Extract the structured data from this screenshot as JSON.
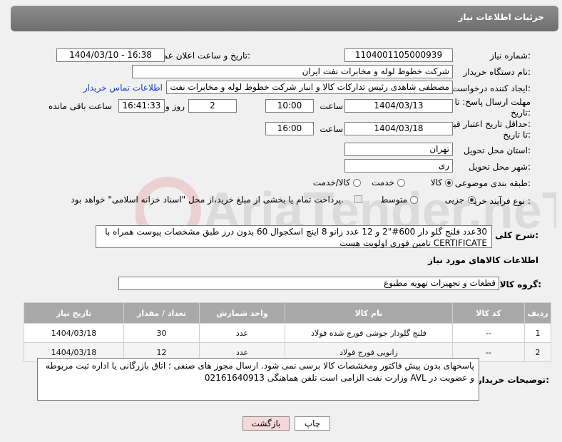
{
  "header": {
    "title": "جزئیات اطلاعات نیاز"
  },
  "watermark": {
    "text": "AriaTender.neT"
  },
  "fields": {
    "need_number_label": "شماره نیاز:",
    "need_number": "1104001105000939",
    "announce_label": "تاریخ و ساعت اعلان عمومی:",
    "announce_value": "1404/03/10 - 16:38",
    "buyer_label": "نام دستگاه خریدار:",
    "buyer_value": "شرکت خطوط لوله و مخابرات نفت ایران",
    "creator_label": "ایجاد کننده درخواست:",
    "creator_value": "مصطفی  شاهدی رئیس تدارکات کالا و انبار شرکت خطوط لوله و مخابرات نفت ایر",
    "contact_link": "اطلاعات تماس خریدار",
    "deadline_label_1": "مهلت ارسال پاسخ: تا",
    "deadline_label_2": "تاریخ:",
    "deadline_date": "1404/03/13",
    "time_label": "ساعت",
    "deadline_time": "10:00",
    "days_value": "2",
    "days_label": "روز و",
    "remaining_time": "16:41:33",
    "remaining_label": "ساعت باقی مانده",
    "validity_label_1": "حداقل تاریخ اعتبار قیمت:",
    "validity_label_2": "تا تاریخ:",
    "validity_date": "1404/03/18",
    "validity_time_label": "ساعت",
    "validity_time": "16:00",
    "province_label": "استان محل تحویل:",
    "province_value": "تهران",
    "city_label": "شهر محل تحویل:",
    "city_value": "ری",
    "category_label": "طبقه بندی موضوعی:",
    "category_options": [
      "کالا",
      "خدمت",
      "کالا/خدمت"
    ],
    "category_selected": "کالا",
    "process_label": "نوع فرآیند خرید :",
    "process_options": [
      "جزیی",
      "متوسط"
    ],
    "process_selected": "جزیی",
    "payment_text": "پرداخت تمام یا بخشی از مبلغ خرید،از محل \"اسناد خزانه اسلامی\" خواهد بود."
  },
  "description": {
    "label": "شرح کلی نیاز:",
    "line1": "30عدد فلنج گلو دار  600#\"2 و 12 عدد زانو 8 اینچ اسکجوال 60 بدون درز طبق مشخصات پیوست همراه با",
    "line2": "CERTIFICATE تامین فوری  اولویت هست"
  },
  "goods_section": {
    "title": "اطلاعات کالاهای مورد نیاز",
    "group_label": "گروه کالا:",
    "group_value": "قطعات و تجهیزات تهویه مطبوع"
  },
  "table": {
    "headers": [
      "ردیف",
      "کد کالا",
      "نام کالا",
      "واحد شمارش",
      "تعداد / مقدار",
      "تاریخ نیاز"
    ],
    "rows": [
      [
        "1",
        "--",
        "فلنج گلودار جوشی فورج شده فولاد",
        "عدد",
        "30",
        "1404/03/18"
      ],
      [
        "2",
        "--",
        "زانویی فورج فولاد",
        "عدد",
        "12",
        "1404/03/18"
      ]
    ]
  },
  "notes": {
    "label": "توضیحات خریدار:",
    "text": "پاسخهای بدون پیش فاکتور ومخشصات کالا برسی نمی شود. ارسال مجوز های صنفی ؛ اتاق بازرگانی یا اداره ثبت  مربوطه و عضویت در AVL وزارت نفت الزامی است تلفن هماهنگی  02161640913"
  },
  "buttons": {
    "print": "چاپ",
    "back": "بازگشت"
  }
}
